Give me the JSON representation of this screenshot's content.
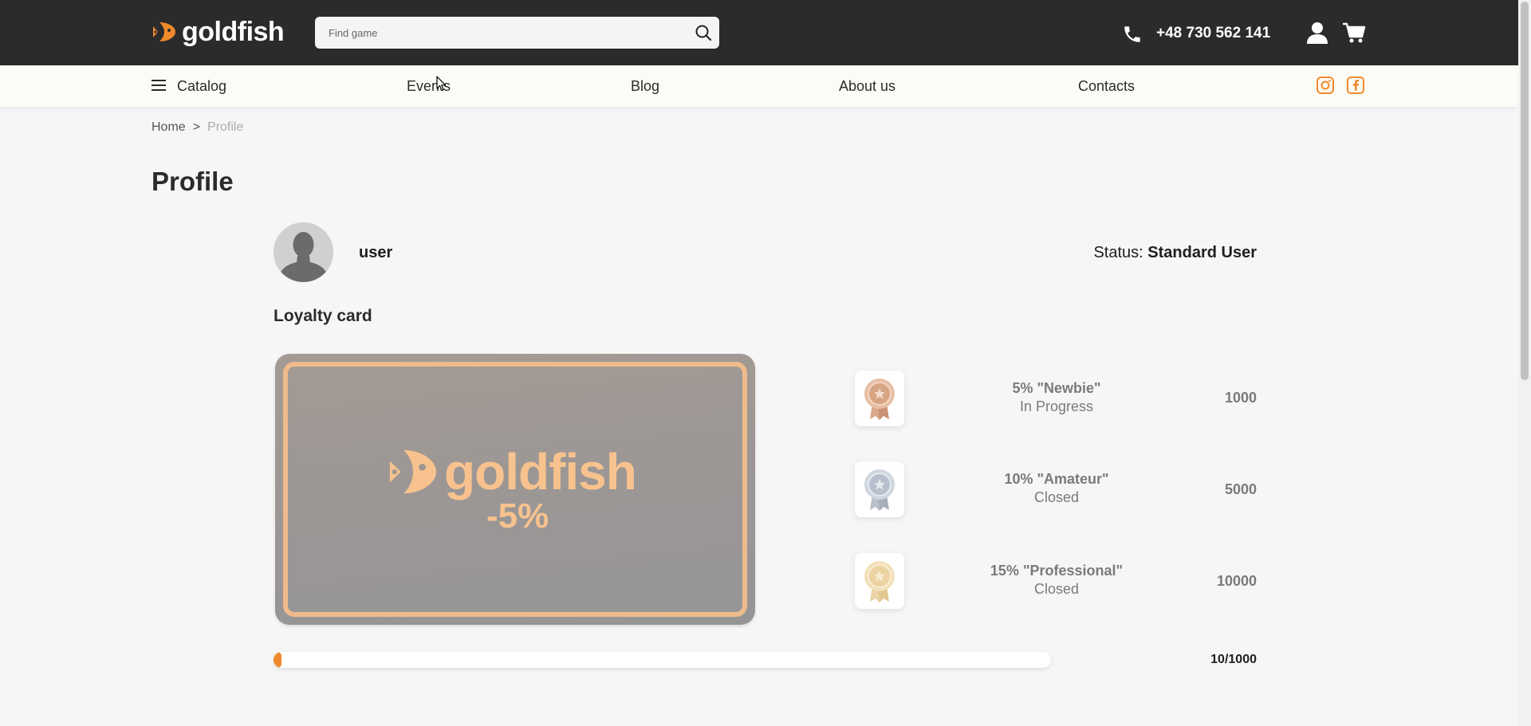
{
  "header": {
    "logo_text": "goldfish",
    "search_placeholder": "Find game",
    "phone": "+48 730 562 141",
    "brand_color": "#f08a2c",
    "dark_color": "#2b2b2b"
  },
  "nav": {
    "catalog": "Catalog",
    "items": [
      "Events",
      "Blog",
      "About us",
      "Contacts"
    ],
    "social": [
      "instagram-icon",
      "facebook-icon"
    ]
  },
  "breadcrumb": {
    "home": "Home",
    "separator": ">",
    "current": "Profile"
  },
  "page_title": "Profile",
  "profile": {
    "username": "user",
    "status_label": "Status:",
    "status_value": "Standard User"
  },
  "loyalty": {
    "title": "Loyalty card",
    "card": {
      "brand": "goldfish",
      "discount": "-5%"
    },
    "tiers": [
      {
        "name": "5% \"Newbie\"",
        "state": "In Progress",
        "points": "1000",
        "medal": "bronze-medal-icon"
      },
      {
        "name": "10% \"Amateur\"",
        "state": "Closed",
        "points": "5000",
        "medal": "silver-medal-icon"
      },
      {
        "name": "15% \"Professional\"",
        "state": "Closed",
        "points": "10000",
        "medal": "gold-medal-icon"
      }
    ],
    "progress": {
      "current": 10,
      "target": 1000,
      "label": "10/1000"
    }
  }
}
